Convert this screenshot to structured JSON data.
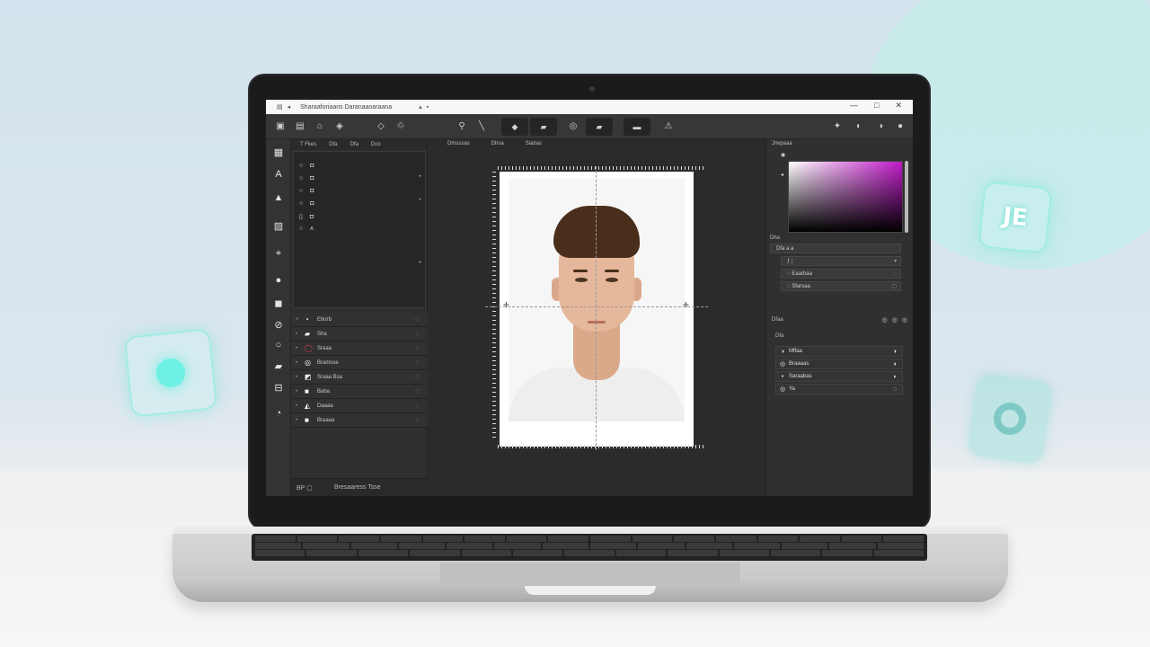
{
  "background": {
    "accent_glow": "#6ff0e4",
    "floating_badge_text": "JE"
  },
  "titlebar": {
    "glyphs": [
      "▤",
      "◂",
      "▸",
      "▪",
      "▴"
    ],
    "title": "Sharaaforiaaris Daranaaoaraana",
    "controls": [
      "—",
      "□",
      "✕"
    ]
  },
  "toolbar": {
    "left_icons": [
      "▣",
      "▤",
      "⌂",
      "◈",
      "◇",
      "♲"
    ],
    "center_icons": [
      "⚲",
      "╲",
      "◆",
      "▰",
      "◎",
      "▰",
      "▬",
      "⚠"
    ],
    "right_icons": [
      "✦",
      "◐",
      "◑",
      "●"
    ]
  },
  "left_rail": {
    "icons": [
      "▦",
      "A",
      "▲",
      "▨",
      "⌖",
      "●",
      "◼",
      "⊘",
      "○",
      "▰",
      "⊟",
      "◔"
    ]
  },
  "layers_panel": {
    "tabs": [
      "T Fkes",
      "Dfa",
      "Dfa",
      "Dco"
    ],
    "lines": [
      {
        "icon": "○",
        "shape": "◘"
      },
      {
        "icon": "○",
        "shape": "◘"
      },
      {
        "icon": "○",
        "shape": "◘"
      },
      {
        "icon": "○",
        "shape": "◘"
      },
      {
        "icon": "▯",
        "shape": "◘"
      },
      {
        "icon": "○",
        "shape": "ʌ"
      }
    ],
    "props": [
      {
        "glyph": "⌕",
        "icon": "◔",
        "label": "Etkrrb",
        "end": "◌"
      },
      {
        "glyph": "•",
        "icon": "▰",
        "label": "Sha",
        "end": "◌"
      },
      {
        "glyph": "•",
        "icon": "◯",
        "label": "Sraaa",
        "end": "◌"
      },
      {
        "glyph": "•",
        "icon": "◎",
        "label": "Bramsse",
        "end": "◌"
      },
      {
        "glyph": "•",
        "icon": "◩",
        "label": "Sraaa Bsa",
        "end": "◌"
      },
      {
        "glyph": "•",
        "icon": "■",
        "label": "Baba",
        "end": "◌"
      },
      {
        "glyph": "•",
        "icon": "◭",
        "label": "Daaaa",
        "end": "◌"
      },
      {
        "glyph": "•",
        "icon": "■",
        "label": "Braaaa",
        "end": "◌"
      }
    ],
    "footer_left": "BP ▢",
    "footer_label": "Bresaaress Tsse",
    "footer_icon": "⎋"
  },
  "canvas": {
    "tabs": [
      "Dmsssas",
      "Dhsa",
      "Siabas"
    ],
    "guide_color": "#9a9a9a"
  },
  "right_panel": {
    "tab": "Jrwpaaa",
    "picker_colors": {
      "from": "#ffffff",
      "to": "#c01ac8"
    },
    "picker_label": "Dha",
    "rows": [
      {
        "label": "Dfa  a a",
        "end": ""
      },
      {
        "label": "ƒ  ¦",
        "end": "▾"
      },
      {
        "label": "◌ Eaarbaa",
        "end": "◌"
      },
      {
        "label": "◌ Sfarsaa",
        "end": "◻"
      }
    ],
    "layers_label": "Dfaa",
    "layers_icons": [
      "◎",
      "◎",
      "◎"
    ],
    "layers_sub": "Dfa",
    "layer_items": [
      {
        "icon": "◑",
        "label": "Mffaa",
        "end": "◑"
      },
      {
        "icon": "◎",
        "label": "Braaaas",
        "end": "◖"
      },
      {
        "icon": "•",
        "label": "Saraabas",
        "end": "◗"
      },
      {
        "icon": "◎",
        "label": "Ya",
        "end": "◌"
      }
    ]
  }
}
